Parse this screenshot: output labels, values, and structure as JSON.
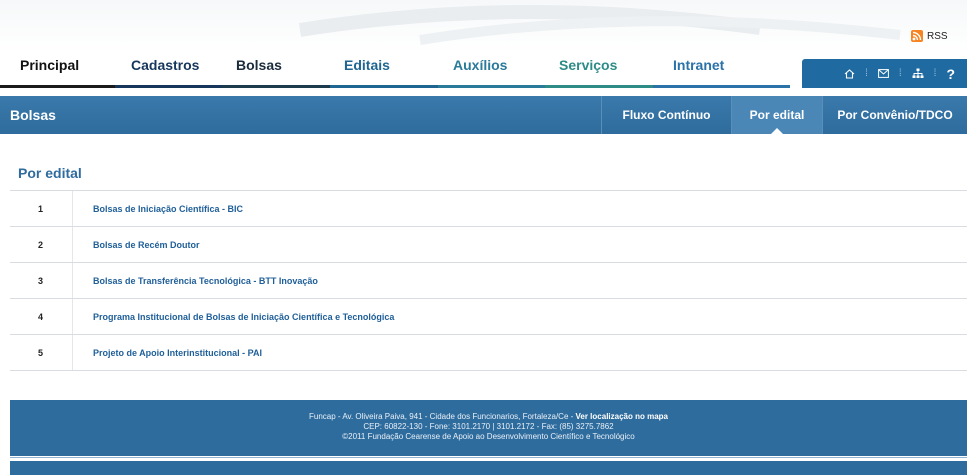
{
  "header": {
    "rss_label": "RSS",
    "nav": [
      {
        "label": "Principal",
        "color": "#111111",
        "bar": "#1b1b1b"
      },
      {
        "label": "Cadastros",
        "color": "#16365c",
        "bar": "#16365c"
      },
      {
        "label": "Bolsas",
        "color": "#1b2b3c",
        "bar": "#1c3c4e"
      },
      {
        "label": "Editais",
        "color": "#1e6691",
        "bar": "#1e6691"
      },
      {
        "label": "Auxílios",
        "color": "#2a7a9a",
        "bar": "#2a7a9a"
      },
      {
        "label": "Serviços",
        "color": "#2d8c86",
        "bar": "#2d8c86"
      },
      {
        "label": "Intranet",
        "color": "#2a72a8",
        "bar": "#2a72a8"
      }
    ],
    "utility": {
      "home_icon": "home-icon",
      "mail_icon": "mail-icon",
      "sitemap_icon": "sitemap-icon",
      "help_label": "?"
    }
  },
  "section": {
    "title": "Bolsas",
    "tabs": [
      {
        "label": "Fluxo Contínuo",
        "active": false
      },
      {
        "label": "Por edital",
        "active": true
      },
      {
        "label": "Por Convênio/TDCO",
        "active": false
      }
    ]
  },
  "page": {
    "heading": "Por edital",
    "items": [
      {
        "num": "1",
        "label": "Bolsas de Iniciação Científica - BIC"
      },
      {
        "num": "2",
        "label": "Bolsas de Recém Doutor"
      },
      {
        "num": "3",
        "label": "Bolsas de Transferência Tecnológica - BTT Inovação"
      },
      {
        "num": "4",
        "label": "Programa Institucional de Bolsas de Iniciação Científica e Tecnológica"
      },
      {
        "num": "5",
        "label": "Projeto de Apoio Interinstitucional - PAI"
      }
    ]
  },
  "footer": {
    "line1_text": "Funcap - Av. Oliveira Paiva, 941 - Cidade dos Funcionarios, Fortaleza/Ce - ",
    "line1_link": "Ver localização no mapa",
    "line2": "CEP: 60822-130 - Fone: 3101.2170 | 3101.2172 - Fax: (85) 3275.7862",
    "line3": "©2011 Fundação Cearense de Apoio ao Desenvolvimento Científico e Tecnológico"
  },
  "colors": {
    "accent": "#2f6c9e",
    "link": "#1f5f99",
    "rss": "#f78422"
  }
}
